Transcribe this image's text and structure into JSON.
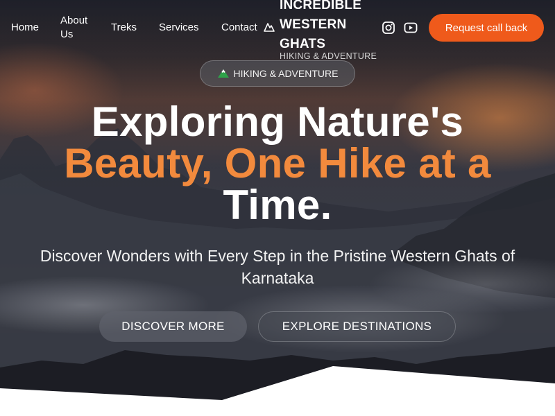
{
  "nav": {
    "links": [
      {
        "label": "Home"
      },
      {
        "label": "About Us"
      },
      {
        "label": "Treks"
      },
      {
        "label": "Services"
      },
      {
        "label": "Contact"
      }
    ]
  },
  "brand": {
    "title": "INCREDIBLE WESTERN GHATS",
    "subtitle": "HIKING & ADVENTURE",
    "icon": "mountain-outline-icon"
  },
  "social": [
    {
      "icon": "instagram-icon"
    },
    {
      "icon": "youtube-icon"
    }
  ],
  "cta": {
    "label": "Request call back"
  },
  "hero": {
    "badge_icon": "mountain-snow-emoji",
    "badge_label": "HIKING & ADVENTURE",
    "headline_line1": "Exploring Nature's",
    "headline_accent": "Beauty, One Hike at a",
    "headline_line3": "Time.",
    "subheadline": "Discover Wonders with Every Step in the Pristine Western Ghats of Karnataka",
    "primary_button": "DISCOVER MORE",
    "secondary_button": "EXPLORE DESTINATIONS"
  },
  "colors": {
    "accent": "#ef5a1b",
    "headline_accent": "#f28a3d",
    "text": "#ffffff"
  }
}
